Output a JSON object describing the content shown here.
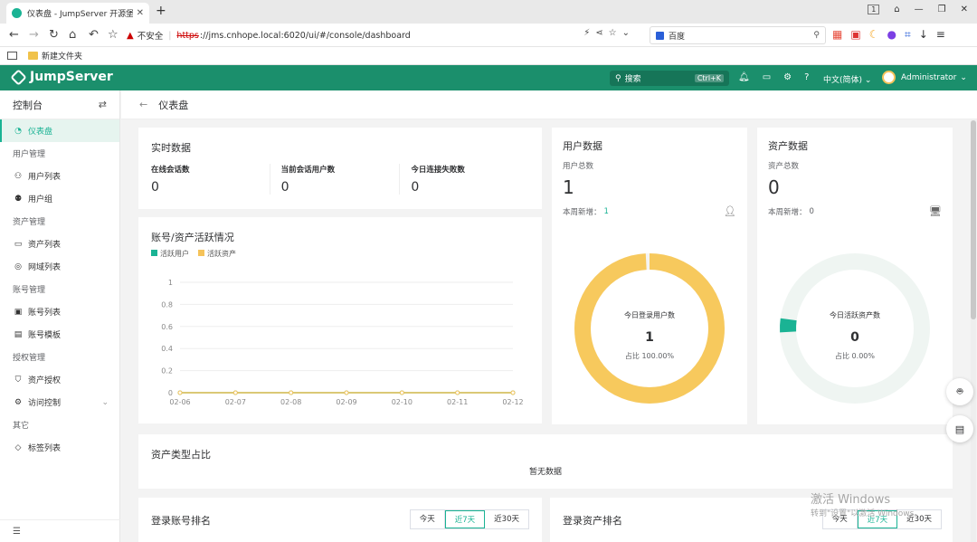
{
  "browser": {
    "tab_title": "仪表盘 - JumpServer 开源堡垒机",
    "security_warning": "不安全",
    "url_scheme": "https",
    "url_rest": "://jms.cnhope.local:6020/ui/#/console/dashboard",
    "search_engine": "百度",
    "window_badge": "1",
    "bookmark_folder": "新建文件夹"
  },
  "header": {
    "brand": "JumpServer",
    "search_placeholder": "搜索",
    "search_shortcut": "Ctrl+K",
    "language": "中文(简体)",
    "username": "Administrator"
  },
  "sidebar": {
    "title": "控制台",
    "items": [
      {
        "type": "item",
        "label": "仪表盘",
        "icon": "dashboard-icon",
        "active": true
      },
      {
        "type": "group",
        "label": "用户管理"
      },
      {
        "type": "item",
        "label": "用户列表",
        "icon": "user-icon"
      },
      {
        "type": "item",
        "label": "用户组",
        "icon": "user-group-icon"
      },
      {
        "type": "group",
        "label": "资产管理"
      },
      {
        "type": "item",
        "label": "资产列表",
        "icon": "monitor-icon"
      },
      {
        "type": "item",
        "label": "网域列表",
        "icon": "location-icon"
      },
      {
        "type": "group",
        "label": "账号管理"
      },
      {
        "type": "item",
        "label": "账号列表",
        "icon": "lock-icon"
      },
      {
        "type": "item",
        "label": "账号模板",
        "icon": "template-icon"
      },
      {
        "type": "group",
        "label": "授权管理"
      },
      {
        "type": "item",
        "label": "资产授权",
        "icon": "shield-icon"
      },
      {
        "type": "item",
        "label": "访问控制",
        "icon": "gear-icon",
        "expandable": true
      },
      {
        "type": "group",
        "label": "其它"
      },
      {
        "type": "item",
        "label": "标签列表",
        "icon": "tag-icon"
      }
    ]
  },
  "breadcrumb": {
    "title": "仪表盘"
  },
  "realtime": {
    "title": "实时数据",
    "metrics": [
      {
        "label": "在线会话数",
        "value": "0"
      },
      {
        "label": "当前会话用户数",
        "value": "0"
      },
      {
        "label": "今日连接失败数",
        "value": "0"
      }
    ]
  },
  "activity": {
    "title": "账号/资产活跃情况",
    "legend": [
      {
        "label": "活跃用户",
        "color": "#1ab394"
      },
      {
        "label": "活跃资产",
        "color": "#f5c35a"
      }
    ]
  },
  "chart_data": {
    "type": "line",
    "x": [
      "02-06",
      "02-07",
      "02-08",
      "02-09",
      "02-10",
      "02-11",
      "02-12"
    ],
    "series": [
      {
        "name": "活跃用户",
        "values": [
          0,
          0,
          0,
          0,
          0,
          0,
          0
        ]
      },
      {
        "name": "活跃资产",
        "values": [
          0,
          0,
          0,
          0,
          0,
          0,
          0
        ]
      }
    ],
    "yticks": [
      "0",
      "0.2",
      "0.4",
      "0.6",
      "0.8",
      "1"
    ],
    "ylim": [
      0,
      1
    ],
    "grid": true,
    "legend_position": "top-left"
  },
  "user_data": {
    "title": "用户数据",
    "total_label": "用户总数",
    "total": "1",
    "week_label": "本周新增：",
    "week_value": "1",
    "ring_title": "今日登录用户数",
    "ring_value": "1",
    "ring_ratio": "占比 100.00%",
    "ratio": 1.0,
    "color": "#f7c95d"
  },
  "asset_data": {
    "title": "资产数据",
    "total_label": "资产总数",
    "total": "0",
    "week_label": "本周新增：",
    "week_value": "0",
    "ring_title": "今日活跃资产数",
    "ring_value": "0",
    "ring_ratio": "占比 0.00%",
    "ratio": 0.0,
    "color": "#1ab394"
  },
  "asset_type": {
    "title": "资产类型占比",
    "empty": "暂无数据"
  },
  "login_account_rank": {
    "title": "登录账号排名",
    "ranges": [
      "今天",
      "近7天",
      "近30天"
    ],
    "selected": 1
  },
  "login_asset_rank": {
    "title": "登录资产排名",
    "ranges": [
      "今天",
      "近7天",
      "近30天"
    ],
    "selected": 1
  },
  "os_watermark": {
    "line1": "激活 Windows",
    "line2": "转到\"设置\"以激活 Windows。"
  }
}
